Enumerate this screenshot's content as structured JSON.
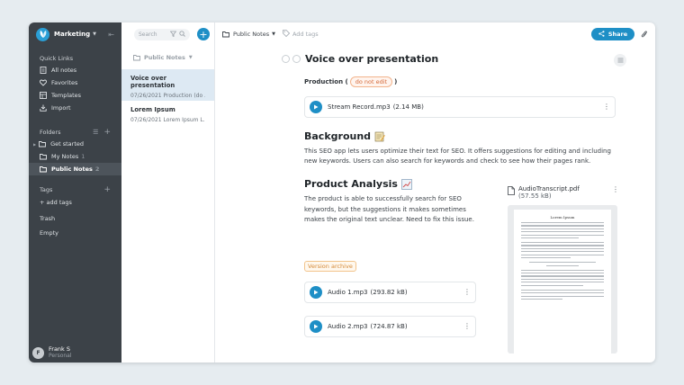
{
  "sidebar": {
    "workspace": "Marketing",
    "quick_links_heading": "Quick Links",
    "quick_links": [
      {
        "label": "All notes",
        "icon": "notes-icon"
      },
      {
        "label": "Favorites",
        "icon": "heart-icon"
      },
      {
        "label": "Templates",
        "icon": "template-icon"
      },
      {
        "label": "Import",
        "icon": "import-icon"
      }
    ],
    "folders_heading": "Folders",
    "folders": [
      {
        "label": "Get started",
        "count": ""
      },
      {
        "label": "My Notes",
        "count": "1"
      },
      {
        "label": "Public Notes",
        "count": "2"
      }
    ],
    "tags_heading": "Tags",
    "add_tags": "+ add tags",
    "trash": "Trash",
    "empty": "Empty",
    "user": {
      "name": "Frank S",
      "plan": "Personal",
      "initial": "F"
    }
  },
  "notelist": {
    "search_placeholder": "Search",
    "folder": "Public Notes",
    "notes": [
      {
        "title": "Voice over presentation",
        "subtitle": "07/26/2021 Production (do ..."
      },
      {
        "title": "Lorem Ipsum",
        "subtitle": "07/26/2021 Lorem Ipsum L..."
      }
    ]
  },
  "main": {
    "breadcrumb": "Public Notes",
    "add_tags": "Add tags",
    "share_label": "Share",
    "title": "Voice over presentation",
    "production_label": "Production (",
    "production_pill": "do not edit",
    "production_close": ")",
    "stream_audio": {
      "name": "Stream Record.mp3",
      "size": "(2.14 MB)"
    },
    "background_heading": "Background",
    "background_text": "This SEO app lets users optimize their text for SEO. It offers suggestions for editing and including new keywords. Users can also search for keywords and check to see how their pages rank.",
    "analysis_heading": "Product Analysis",
    "analysis_text": "The product is able to successfully search for SEO keywords, but the suggestions it makes sometimes makes the original text unclear. Need to fix this issue.",
    "version_label": "Version archive",
    "audio1": {
      "name": "Audio 1.mp3",
      "size": "(293.82 kB)"
    },
    "audio2": {
      "name": "Audio 2.mp3",
      "size": "(724.87 kB)"
    },
    "pdf": {
      "name": "AudioTranscript.pdf",
      "size": "(57.55 kB)",
      "page_title": "Lorem Ipsum"
    }
  },
  "colors": {
    "accent": "#1e8fc6",
    "sidebar": "#3c4248",
    "selected": "#dde9f3",
    "pill": "#d46a3a"
  }
}
